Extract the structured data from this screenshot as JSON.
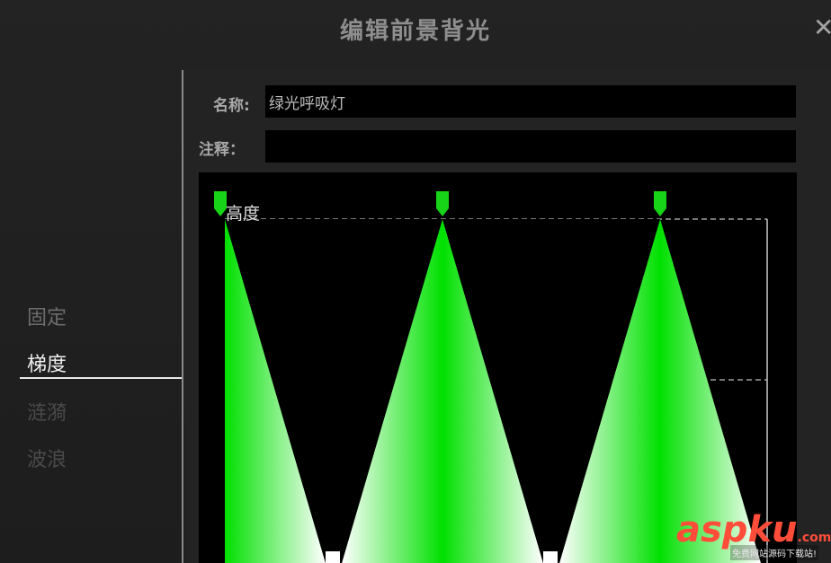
{
  "dialog": {
    "title": "编辑前景背光",
    "close_glyph": "✕"
  },
  "sidebar": {
    "items": [
      {
        "label": "固定",
        "state": "normal"
      },
      {
        "label": "梯度",
        "state": "active"
      },
      {
        "label": "涟漪",
        "state": "dim"
      },
      {
        "label": "波浪",
        "state": "dim"
      }
    ]
  },
  "form": {
    "name_label": "名称:",
    "name_value": "绿光呼吸灯",
    "note_label": "注释：",
    "note_value": ""
  },
  "chart": {
    "y_label": "高度",
    "colors": {
      "peak": "#00e000",
      "edge": "#ffffff",
      "handle": "#18d418",
      "grid": "#9a9a9a"
    }
  },
  "watermark": {
    "asp": "asp",
    "ku": "ku",
    "com": ".com",
    "sub": "免费网站源码下载站!"
  }
}
